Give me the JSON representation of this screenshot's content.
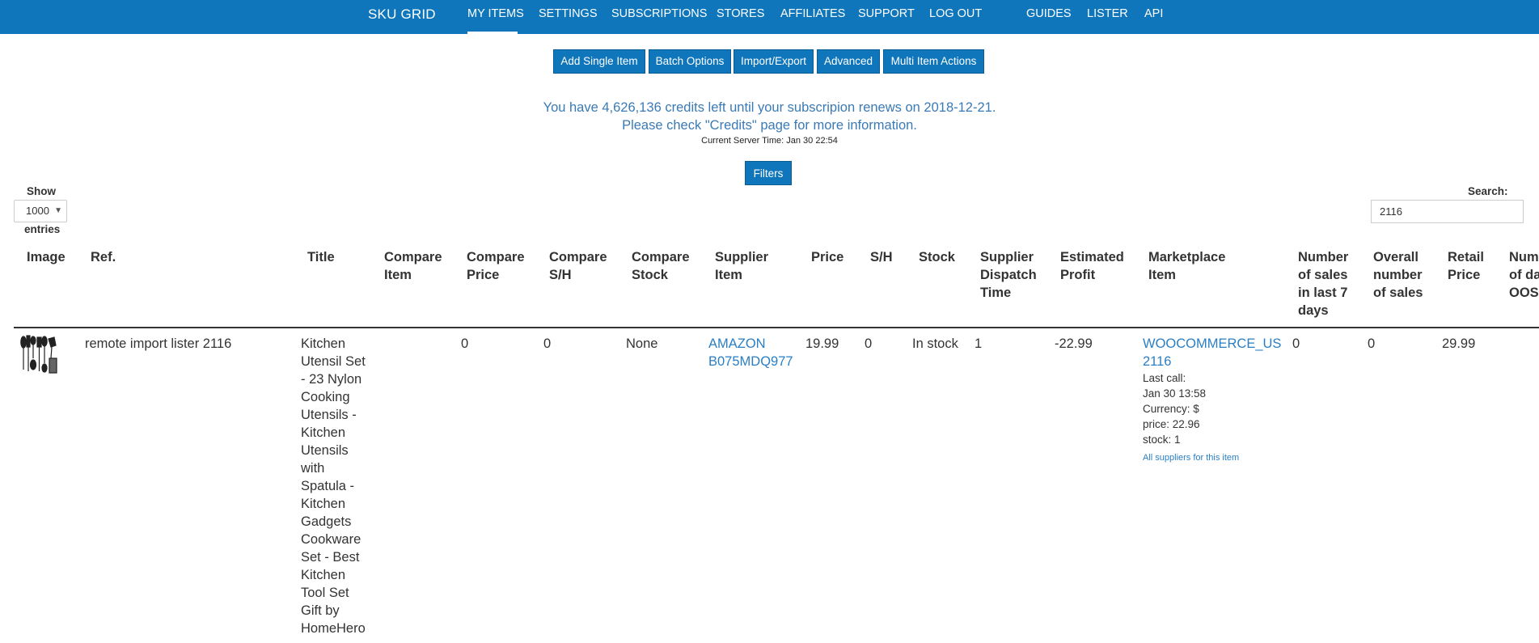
{
  "nav": {
    "brand": "SKU GRID",
    "links": [
      {
        "label": "MY ITEMS",
        "active": true
      },
      {
        "label": "SETTINGS"
      },
      {
        "label": "SUBSCRIPTIONS"
      },
      {
        "label": "STORES"
      },
      {
        "label": "AFFILIATES"
      },
      {
        "label": "SUPPORT"
      },
      {
        "label": "LOG OUT"
      },
      {
        "label": "GUIDES"
      },
      {
        "label": "LISTER"
      },
      {
        "label": "API"
      }
    ]
  },
  "actions": [
    "Add Single Item",
    "Batch Options",
    "Import/Export",
    "Advanced",
    "Multi Item Actions"
  ],
  "info": {
    "credits_line": "You have 4,626,136 credits left until your subscripion renews on 2018-12-21.",
    "check_prefix": "Please check ",
    "check_link": "\"Credits\"",
    "check_suffix": " page for more information.",
    "server_time": "Current Server Time: Jan 30 22:54"
  },
  "filters_label": "Filters",
  "length": {
    "show_label": "Show",
    "value": "1000",
    "entries_label": "entries"
  },
  "search": {
    "label": "Search:",
    "value": "2116"
  },
  "table": {
    "headers": {
      "image": "Image",
      "ref": "Ref.",
      "title": "Title",
      "compare_item": [
        "Compare",
        "Item"
      ],
      "compare_price": [
        "Compare",
        "Price"
      ],
      "compare_sh": [
        "Compare",
        "S/H"
      ],
      "compare_stock": [
        "Compare",
        "Stock"
      ],
      "supplier_item": [
        "Supplier",
        "Item"
      ],
      "price": "Price",
      "sh": "S/H",
      "stock": "Stock",
      "dispatch": [
        "Supplier",
        "Dispatch",
        "Time"
      ],
      "profit": [
        "Estimated",
        "Profit"
      ],
      "marketplace": [
        "Marketplace",
        "Item"
      ],
      "sales7": [
        "Number",
        "of sales",
        "in last 7",
        "days"
      ],
      "overall_sales": [
        "Overall",
        "number",
        "of sales"
      ],
      "retail": [
        "Retail",
        "Price"
      ],
      "days_oos": [
        "Number",
        "of days",
        "OOS"
      ]
    },
    "rows": [
      {
        "ref": "remote import lister 2116",
        "title_lines": [
          "Kitchen",
          "Utensil Set",
          "- 23 Nylon",
          "Cooking",
          "Utensils -",
          "Kitchen",
          "Utensils",
          "with",
          "Spatula -",
          "Kitchen",
          "Gadgets",
          "Cookware",
          "Set - Best",
          "Kitchen",
          "Tool Set",
          "Gift by",
          "HomeHero"
        ],
        "compare_item": "",
        "compare_price": "0",
        "compare_sh": "0",
        "compare_stock": "None",
        "supplier_item": [
          "AMAZON",
          "B075MDQ977"
        ],
        "price": "19.99",
        "sh": "0",
        "stock": "In stock",
        "dispatch": "1",
        "profit": "-22.99",
        "marketplace_item": [
          "WOOCOMMERCE_US",
          "2116"
        ],
        "last_call_label": "Last call:",
        "last_call": "Jan 30 13:58",
        "currency": "Currency: $",
        "mp_price": "price: 22.96",
        "mp_stock": "stock: 1",
        "all_suppliers": "All suppliers for this item",
        "sales7": "0",
        "overall_sales": "0",
        "retail": "29.99"
      }
    ]
  },
  "colors": {
    "navbar": "#0f76bc",
    "button": "#0f76bc",
    "link": "#2a7fc4",
    "info_text": "#3a7ab5"
  }
}
